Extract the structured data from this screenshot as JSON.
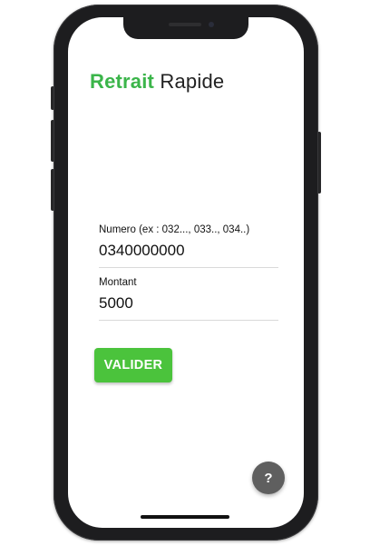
{
  "app": {
    "title_accent": "Retrait",
    "title_rest": "Rapide"
  },
  "form": {
    "number": {
      "label": "Numero (ex : 032..., 033.., 034..)",
      "value": "0340000000"
    },
    "amount": {
      "label": "Montant",
      "value": "5000"
    },
    "submit_label": "VALIDER"
  },
  "help": {
    "label": "?"
  },
  "colors": {
    "accent": "#3bb54a",
    "button": "#4bc33c",
    "fab": "#5f5f5f",
    "frame": "#1d1d1f"
  }
}
